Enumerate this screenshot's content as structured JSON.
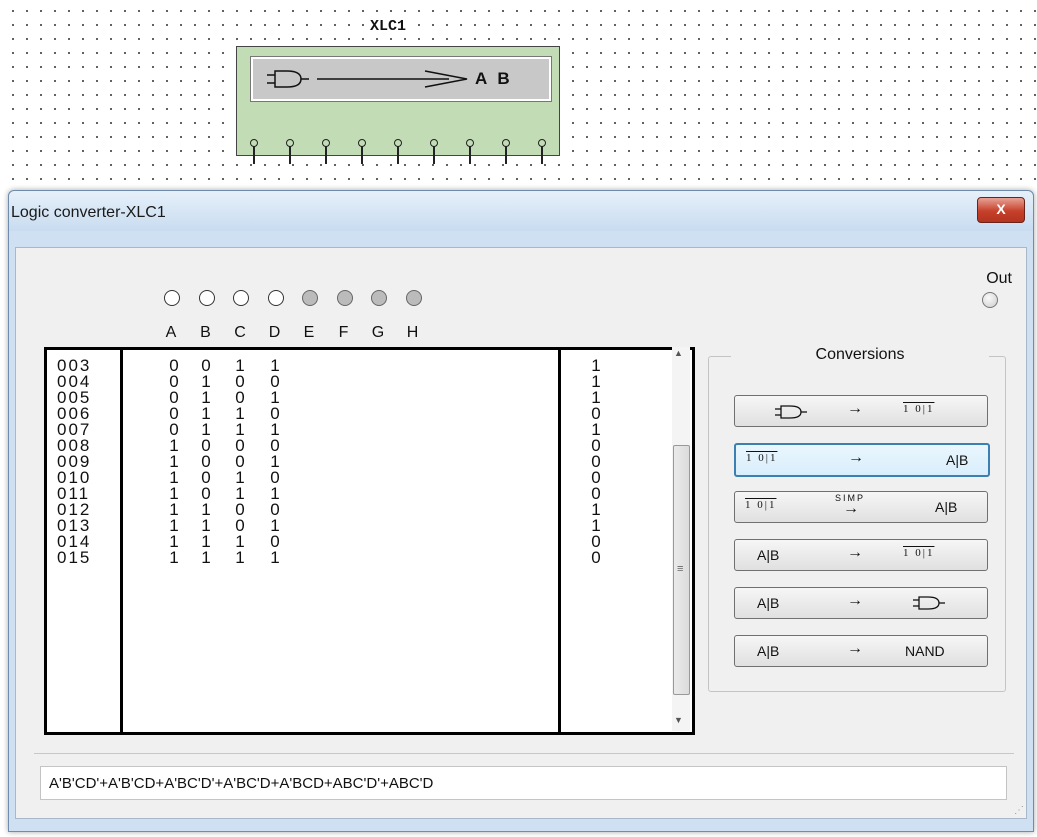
{
  "instrument": {
    "label": "XLC1",
    "display_text": "A B"
  },
  "window": {
    "title": "Logic converter-XLC1",
    "close_label": "X"
  },
  "output": {
    "label": "Out"
  },
  "inputs": {
    "columns": [
      "A",
      "B",
      "C",
      "D",
      "E",
      "F",
      "G",
      "H"
    ],
    "led_states": [
      "off",
      "off",
      "off",
      "off",
      "dim",
      "dim",
      "dim",
      "dim"
    ]
  },
  "truth_table": {
    "rows": [
      {
        "index": "003",
        "A": "0",
        "B": "0",
        "C": "1",
        "D": "1",
        "out": "1"
      },
      {
        "index": "004",
        "A": "0",
        "B": "1",
        "C": "0",
        "D": "0",
        "out": "1"
      },
      {
        "index": "005",
        "A": "0",
        "B": "1",
        "C": "0",
        "D": "1",
        "out": "1"
      },
      {
        "index": "006",
        "A": "0",
        "B": "1",
        "C": "1",
        "D": "0",
        "out": "0"
      },
      {
        "index": "007",
        "A": "0",
        "B": "1",
        "C": "1",
        "D": "1",
        "out": "1"
      },
      {
        "index": "008",
        "A": "1",
        "B": "0",
        "C": "0",
        "D": "0",
        "out": "0"
      },
      {
        "index": "009",
        "A": "1",
        "B": "0",
        "C": "0",
        "D": "1",
        "out": "0"
      },
      {
        "index": "010",
        "A": "1",
        "B": "0",
        "C": "1",
        "D": "0",
        "out": "0"
      },
      {
        "index": "011",
        "A": "1",
        "B": "0",
        "C": "1",
        "D": "1",
        "out": "0"
      },
      {
        "index": "012",
        "A": "1",
        "B": "1",
        "C": "0",
        "D": "0",
        "out": "1"
      },
      {
        "index": "013",
        "A": "1",
        "B": "1",
        "C": "0",
        "D": "1",
        "out": "1"
      },
      {
        "index": "014",
        "A": "1",
        "B": "1",
        "C": "1",
        "D": "0",
        "out": "0"
      },
      {
        "index": "015",
        "A": "1",
        "B": "1",
        "C": "1",
        "D": "1",
        "out": "0"
      }
    ]
  },
  "conversions": {
    "title": "Conversions",
    "truth_table_symbol": "1 0|1",
    "expression_symbol": "A|B",
    "simp_label": "SIMP",
    "nand_label": "NAND",
    "arrow": "→"
  },
  "expression": {
    "value": "A'B'CD'+A'B'CD+A'BC'D'+A'BC'D+A'BCD+ABC'D'+ABC'D"
  }
}
